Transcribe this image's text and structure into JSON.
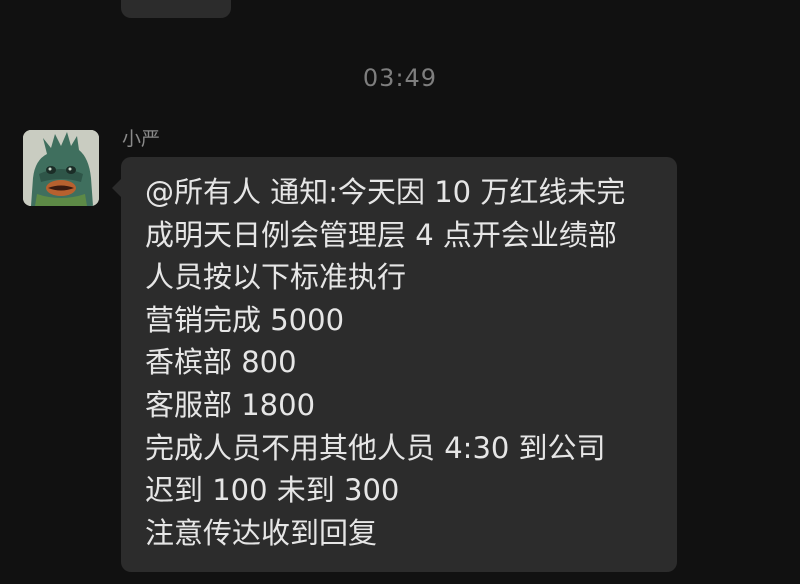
{
  "chat": {
    "timestamp": "03:49",
    "message": {
      "sender": "小严",
      "avatar_icon": "green-masked-monster-avatar",
      "lines": [
        "@所有人 通知:今天因 10 万红线未完",
        "成明天日例会管理层 4 点开会业绩部",
        "人员按以下标准执行",
        "营销完成 5000",
        "香槟部 800",
        "客服部 1800",
        "完成人员不用其他人员 4:30 到公司",
        "迟到 100 未到 300",
        "注意传达收到回复"
      ]
    }
  },
  "colors": {
    "background": "#111111",
    "bubble": "#2c2c2c",
    "text": "#e6e6e6",
    "muted": "#7e7e7e"
  }
}
